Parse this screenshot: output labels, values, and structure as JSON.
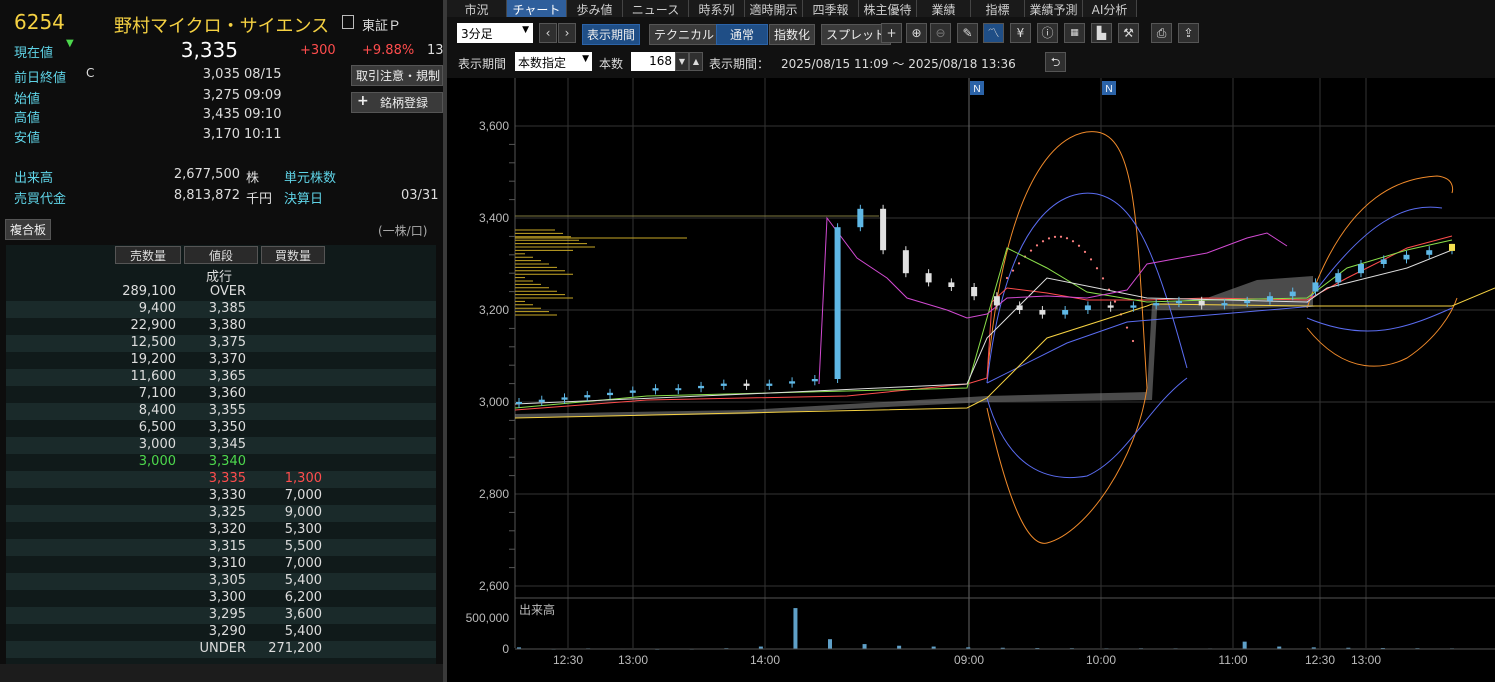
{
  "stock": {
    "code": "6254",
    "name": "野村マイクロ・サイエンス",
    "market": "東証Ｐ",
    "current_label": "現在値",
    "current_price": "3,335",
    "change": "+300",
    "change_pct": "+9.88%",
    "change_pct_trail": "13",
    "prev_close_label": "前日終値",
    "prev_close_flag": "C",
    "prev_close": "3,035",
    "prev_close_date": "08/15",
    "open_label": "始値",
    "open": "3,275",
    "open_time": "09:09",
    "high_label": "高値",
    "high": "3,435",
    "high_time": "09:10",
    "low_label": "安値",
    "low": "3,170",
    "low_time": "10:11",
    "volume_label": "出来高",
    "volume": "2,677,500",
    "volume_unit": "株",
    "unit_shares_label": "単元株数",
    "turnover_label": "売買代金",
    "turnover": "8,813,872",
    "turnover_unit": "千円",
    "settlement_label": "決算日",
    "settlement": "03/31",
    "caution_button": "取引注意・規制",
    "register_button": "銘柄登録"
  },
  "orderbook": {
    "title": "複合板",
    "unit_note": "(一株/口)",
    "headers": [
      "売数量",
      "値段",
      "買数量"
    ],
    "market_order_label": "成行",
    "rows": [
      {
        "sell": "289,100",
        "price": "OVER",
        "buy": ""
      },
      {
        "sell": "9,400",
        "price": "3,385",
        "buy": ""
      },
      {
        "sell": "22,900",
        "price": "3,380",
        "buy": ""
      },
      {
        "sell": "12,500",
        "price": "3,375",
        "buy": ""
      },
      {
        "sell": "19,200",
        "price": "3,370",
        "buy": ""
      },
      {
        "sell": "11,600",
        "price": "3,365",
        "buy": ""
      },
      {
        "sell": "7,100",
        "price": "3,360",
        "buy": ""
      },
      {
        "sell": "8,400",
        "price": "3,355",
        "buy": ""
      },
      {
        "sell": "6,500",
        "price": "3,350",
        "buy": ""
      },
      {
        "sell": "3,000",
        "price": "3,345",
        "buy": ""
      },
      {
        "sell": "3,000",
        "price": "3,340",
        "buy": "",
        "highlight": "green"
      },
      {
        "sell": "",
        "price": "3,335",
        "buy": "1,300",
        "highlight": "red"
      },
      {
        "sell": "",
        "price": "3,330",
        "buy": "7,000"
      },
      {
        "sell": "",
        "price": "3,325",
        "buy": "9,000"
      },
      {
        "sell": "",
        "price": "3,320",
        "buy": "5,300"
      },
      {
        "sell": "",
        "price": "3,315",
        "buy": "5,500"
      },
      {
        "sell": "",
        "price": "3,310",
        "buy": "7,000"
      },
      {
        "sell": "",
        "price": "3,305",
        "buy": "5,400"
      },
      {
        "sell": "",
        "price": "3,300",
        "buy": "6,200"
      },
      {
        "sell": "",
        "price": "3,295",
        "buy": "3,600"
      },
      {
        "sell": "",
        "price": "3,290",
        "buy": "5,400"
      },
      {
        "sell": "",
        "price": "UNDER",
        "buy": "271,200"
      }
    ]
  },
  "tabs": [
    "市況",
    "チャート",
    "歩み値",
    "ニュース",
    "時系列",
    "適時開示",
    "四季報",
    "株主優待",
    "業績",
    "指標",
    "業績予測",
    "AI分析"
  ],
  "active_tab": "チャート",
  "toolbar": {
    "interval": "3分足",
    "period_button": "表示期間",
    "technical_button": "テクニカル",
    "normal_button": "通常",
    "index_button": "指数化",
    "spread_button": "スプレッド",
    "icons": [
      "plus-icon",
      "zoom-in-icon",
      "zoom-out-icon",
      "pencil-icon",
      "chart-type-icon",
      "yen-icon",
      "info-icon",
      "compare-icon",
      "volume-profile-icon",
      "wrench-icon",
      "print-icon",
      "export-icon"
    ]
  },
  "period_bar": {
    "label": "表示期間",
    "mode": "本数指定",
    "count_label": "本数",
    "count": "168",
    "range_label": "表示期間：",
    "range": "2025/08/15 11:09 〜 2025/08/18 13:36"
  },
  "chart_data": {
    "type": "candlestick",
    "y_ticks": [
      "3,600",
      "3,400",
      "3,200",
      "3,000",
      "2,800",
      "2,600"
    ],
    "ylim": [
      2600,
      3600
    ],
    "x_ticks": [
      "12:30",
      "13:00",
      "14:00",
      "09:00",
      "10:00",
      "11:00",
      "12:30",
      "13:00"
    ],
    "news_markers": [
      "N",
      "N"
    ],
    "volume_label": "出来高",
    "volume_ticks": [
      "500,000",
      "0"
    ],
    "close_series": [
      3000,
      3005,
      3010,
      3015,
      3020,
      3025,
      3030,
      3030,
      3035,
      3040,
      3035,
      3040,
      3045,
      3050,
      3380,
      3420,
      3330,
      3280,
      3260,
      3250,
      3230,
      3210,
      3200,
      3190,
      3200,
      3210,
      3205,
      3210,
      3215,
      3220,
      3210,
      3215,
      3220,
      3230,
      3240,
      3260,
      3280,
      3300,
      3310,
      3320,
      3330,
      3335
    ],
    "volume_series": [
      20000,
      5000,
      8000,
      6000,
      4000,
      5000,
      10000,
      30000,
      500000,
      120000,
      60000,
      40000,
      30000,
      20000,
      15000,
      12000,
      10000,
      8000,
      9000,
      8000,
      7000,
      90000,
      30000,
      20000,
      15000,
      12000,
      10000,
      8000
    ],
    "colors": {
      "up": "#5fb8e6",
      "down": "#e0e0e0",
      "bb_outer": "#f08a2a",
      "bb_inner": "#5a6cf0",
      "ma_short": "#ff4d4d",
      "ma_mid": "#8adf4a",
      "ma_long": "#f5d142",
      "rsi": "#d24ad2",
      "ichimoku_cloud": "#888888",
      "highlight": "#f5e050"
    }
  }
}
